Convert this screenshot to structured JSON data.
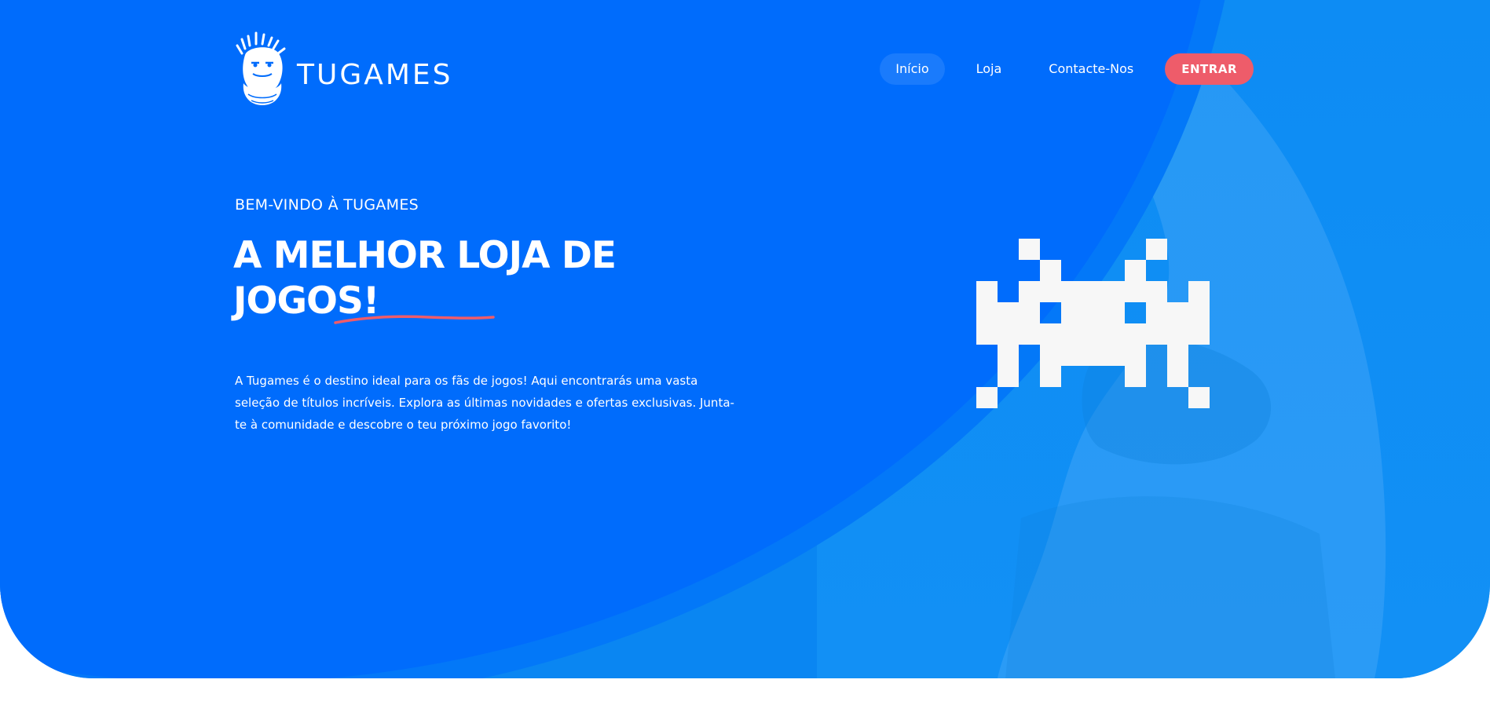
{
  "brand": {
    "name": "TUGAMES"
  },
  "nav": {
    "items": [
      {
        "label": "Início",
        "active": true
      },
      {
        "label": "Loja",
        "active": false
      },
      {
        "label": "Contacte-Nos",
        "active": false
      }
    ],
    "cta_label": "ENTRAR"
  },
  "hero": {
    "kicker": "BEM-VINDO À TUGAMES",
    "headline_line1": "A MELHOR LOJA DE",
    "headline_line2": "JOGOS!",
    "description": "A Tugames é o destino ideal para os fãs de jogos! Aqui encontrarás uma vasta seleção de títulos incríveis. Explora as últimas novidades e ofertas exclusivas. Junta-te à comunidade e descobre o teu próximo jogo favorito!",
    "illustration": "space-invader-icon"
  },
  "colors": {
    "primary": "#006cfc",
    "secondary": "#0d8cf4",
    "accent": "#ee5c6a",
    "text": "#ffffff",
    "invader": "#f7f7f7"
  }
}
